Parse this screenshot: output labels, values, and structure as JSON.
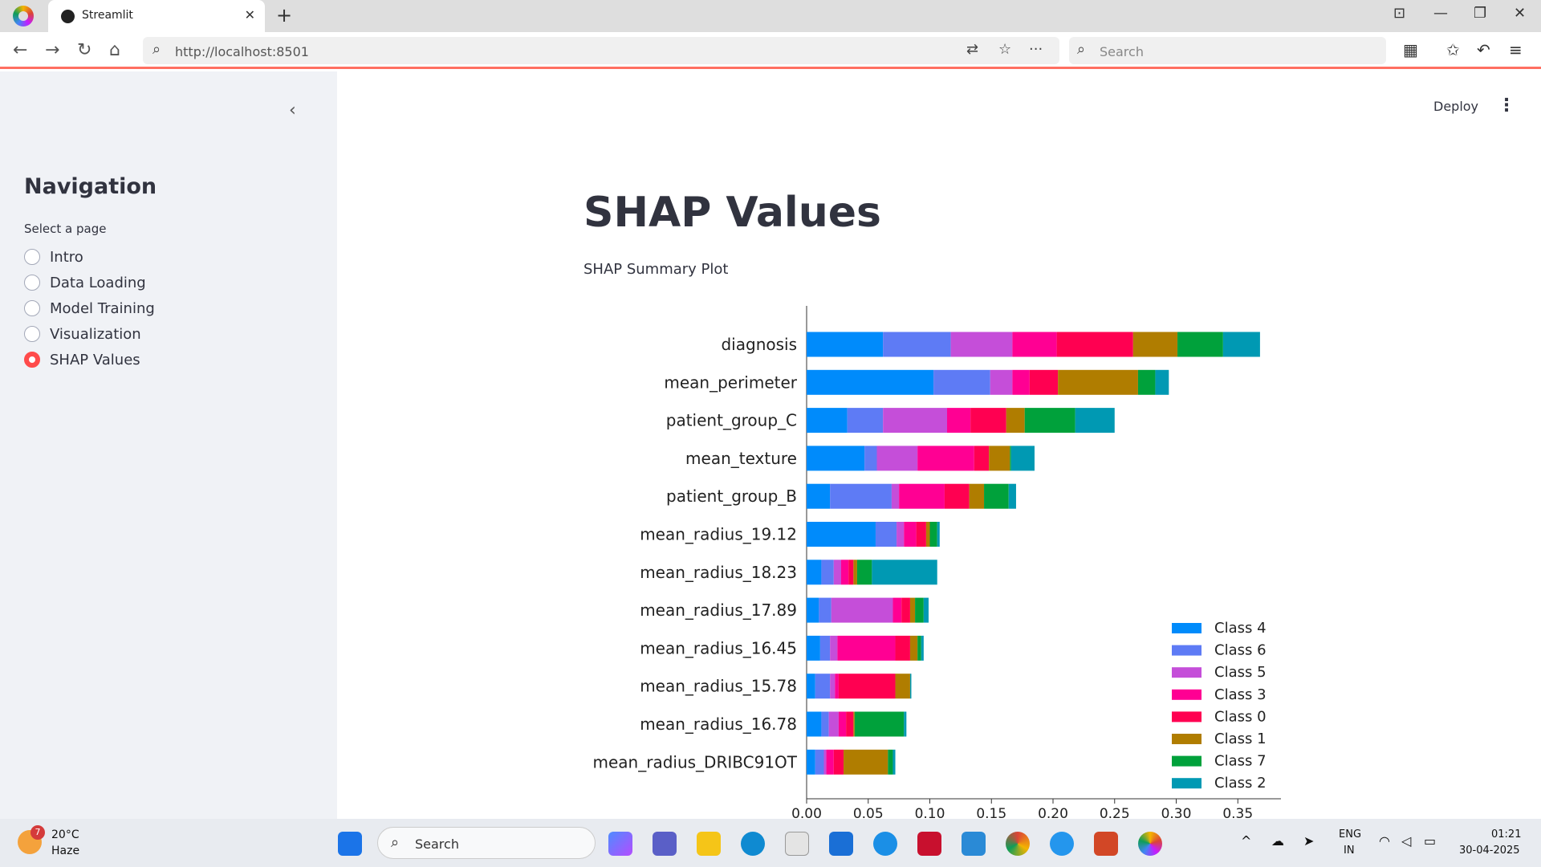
{
  "browser": {
    "tab_title": "Streamlit",
    "tab_close": "✕",
    "new_tab": "+",
    "url": "http://localhost:8501",
    "search_placeholder": "Search"
  },
  "sidebar": {
    "collapse_icon": "‹",
    "title": "Navigation",
    "select_label": "Select a page",
    "items": [
      {
        "label": "Intro",
        "selected": false
      },
      {
        "label": "Data Loading",
        "selected": false
      },
      {
        "label": "Model Training",
        "selected": false
      },
      {
        "label": "Visualization",
        "selected": false
      },
      {
        "label": "SHAP Values",
        "selected": true
      }
    ]
  },
  "header": {
    "deploy_label": "Deploy",
    "menu_icon": "⋮"
  },
  "main": {
    "title": "SHAP Values",
    "caption": "SHAP Summary Plot"
  },
  "chart_data": {
    "type": "bar",
    "orientation": "horizontal-stacked",
    "categories": [
      "diagnosis",
      "mean_perimeter",
      "patient_group_C",
      "mean_texture",
      "patient_group_B",
      "mean_radius_19.12",
      "mean_radius_18.23",
      "mean_radius_17.89",
      "mean_radius_16.45",
      "mean_radius_15.78",
      "mean_radius_16.78",
      "mean_radius_DRIBC91OT"
    ],
    "series": [
      {
        "name": "Class 4",
        "color": "#008bfb",
        "values": [
          0.062,
          0.103,
          0.033,
          0.047,
          0.019,
          0.056,
          0.012,
          0.01,
          0.011,
          0.007,
          0.012,
          0.007
        ]
      },
      {
        "name": "Class 6",
        "color": "#5e7bf5",
        "values": [
          0.055,
          0.046,
          0.029,
          0.01,
          0.05,
          0.017,
          0.01,
          0.01,
          0.008,
          0.012,
          0.006,
          0.007
        ]
      },
      {
        "name": "Class 5",
        "color": "#c54ed9",
        "values": [
          0.05,
          0.018,
          0.052,
          0.033,
          0.006,
          0.006,
          0.006,
          0.05,
          0.006,
          0.004,
          0.008,
          0.002
        ]
      },
      {
        "name": "Class 3",
        "color": "#ff0093",
        "values": [
          0.036,
          0.014,
          0.019,
          0.046,
          0.037,
          0.01,
          0.006,
          0.007,
          0.047,
          0.003,
          0.006,
          0.006
        ]
      },
      {
        "name": "Class 0",
        "color": "#ff0051",
        "values": [
          0.062,
          0.023,
          0.029,
          0.012,
          0.02,
          0.008,
          0.004,
          0.007,
          0.012,
          0.046,
          0.006,
          0.008
        ]
      },
      {
        "name": "Class 1",
        "color": "#b07d00",
        "values": [
          0.036,
          0.065,
          0.015,
          0.017,
          0.012,
          0.003,
          0.003,
          0.004,
          0.006,
          0.012,
          0.001,
          0.036
        ]
      },
      {
        "name": "Class 7",
        "color": "#00a13b",
        "values": [
          0.037,
          0.014,
          0.041,
          0.001,
          0.02,
          0.006,
          0.012,
          0.007,
          0.003,
          0.0,
          0.04,
          0.004
        ]
      },
      {
        "name": "Class 2",
        "color": "#0099b3",
        "values": [
          0.03,
          0.011,
          0.032,
          0.019,
          0.006,
          0.002,
          0.053,
          0.004,
          0.002,
          0.001,
          0.002,
          0.002
        ]
      }
    ],
    "xticks": [
      "0.00",
      "0.05",
      "0.10",
      "0.15",
      "0.20",
      "0.25",
      "0.30",
      "0.35"
    ],
    "xlim": [
      0,
      0.385
    ],
    "legend_position": "bottom-right"
  },
  "taskbar": {
    "weather_temp": "20°C",
    "weather_desc": "Haze",
    "weather_badge": "7",
    "search_label": "Search",
    "lang_line1": "ENG",
    "lang_line2": "IN",
    "time": "01:21",
    "date": "30-04-2025"
  }
}
